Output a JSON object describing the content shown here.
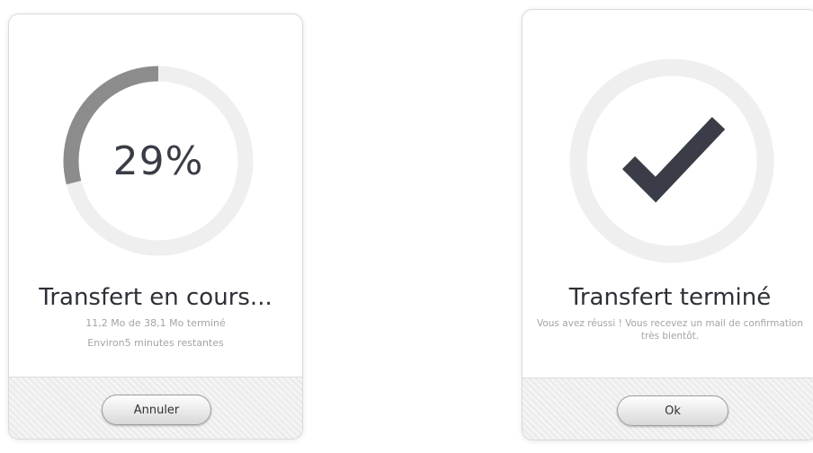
{
  "progress_dialog": {
    "percent_text": "29%",
    "progress": 0.29,
    "title": "Transfert en cours...",
    "detail": "11,2 Mo de 38,1 Mo terminé",
    "remaining": "Environ5 minutes restantes",
    "cancel_label": "Annuler",
    "colors": {
      "track": "#efefef",
      "fill": "#8c8c8c"
    }
  },
  "done_dialog": {
    "title": "Transfert terminé",
    "message": "Vous avez réussi ! Vous recevez un mail de confirmation très bientôt.",
    "ok_label": "Ok",
    "icon": "checkmark-icon",
    "colors": {
      "ring": "#efefef",
      "check": "#3a3d47"
    }
  }
}
